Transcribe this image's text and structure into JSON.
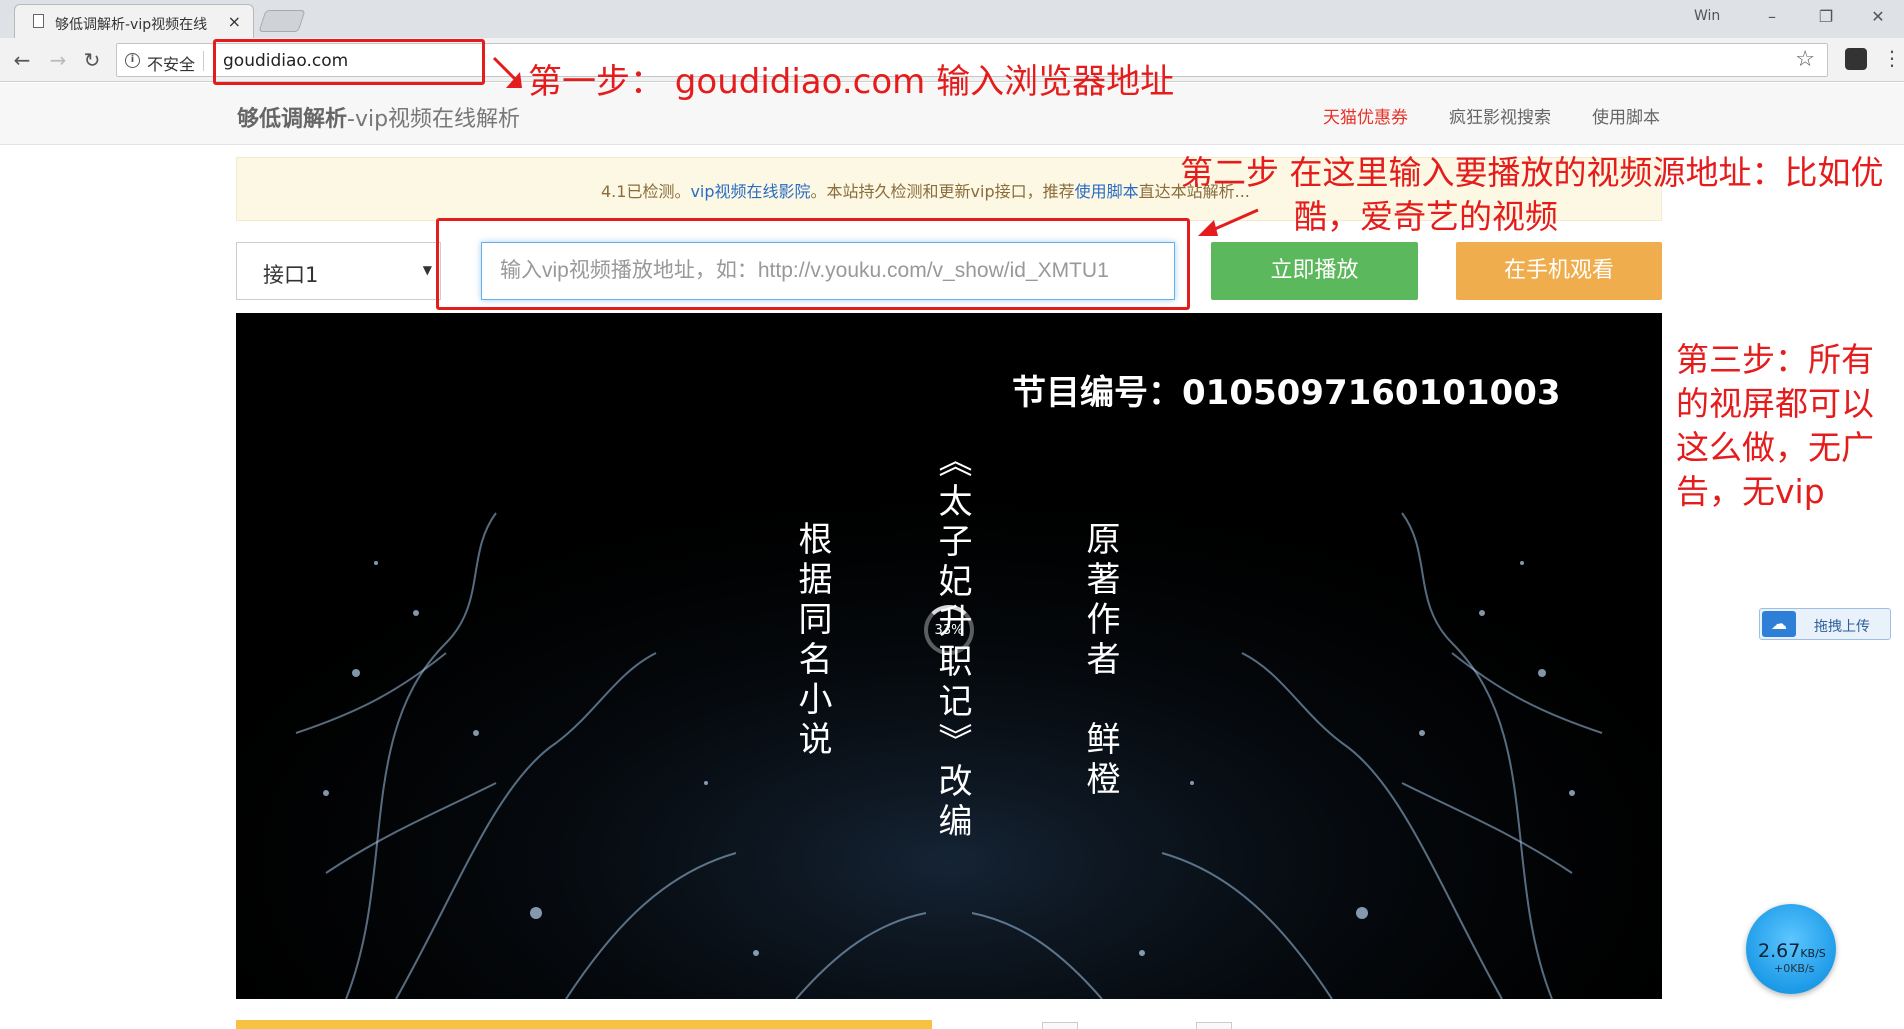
{
  "browser": {
    "tab_title": "够低调解析-vip视频在线",
    "tab_close": "×",
    "window_label": "Win",
    "insecure_label": "不安全",
    "url": "goudidiao.com"
  },
  "site": {
    "brand_bold": "够低调解析",
    "brand_rest": "-vip视频在线解析",
    "nav": [
      {
        "label": "天猫优惠券",
        "color": "#e5332a"
      },
      {
        "label": "疯狂影视搜索",
        "color": "#666666"
      },
      {
        "label": "使用脚本",
        "color": "#666666"
      }
    ]
  },
  "notice": {
    "prefix": "4.1已检测。",
    "link1": "vip视频在线影院",
    "middle": "。本站持久检测和更新vip接口，推荐",
    "link2": "使用脚本",
    "suffix": "直达本站解析..."
  },
  "player": {
    "interface_value": "接口1",
    "input_placeholder": "输入vip视频播放地址，如：http://v.youku.com/v_show/id_XMTU1",
    "play_label": "立即播放",
    "mobile_label": "在手机观看"
  },
  "video": {
    "program_code": "节目编号：0105097160101003",
    "col_left": "根据同名小说",
    "col_center": "《太子妃升职记》改编",
    "col_right": "原著作者　鲜橙",
    "loading_percent": "33%"
  },
  "annotations": {
    "step1": "第一步： goudidiao.com 输入浏览器地址",
    "step2_line1": "第二步  在这里输入要播放的视频源地址：比如优",
    "step2_line2": "酷，爱奇艺的视频",
    "step3_lines": [
      "第三步：所有",
      "的视屏都可以",
      "这么做，无广",
      "告，无vip"
    ]
  },
  "widgets": {
    "upload_label": "拖拽上传",
    "speed_value": "2.67",
    "speed_unit": "KB/S",
    "speed_sub": "+0KB/s"
  },
  "colors": {
    "annotation_red": "#e51c1c",
    "play_green": "#5cb85c",
    "mobile_orange": "#f0ad4e",
    "notice_bg": "#fcf8e3"
  }
}
